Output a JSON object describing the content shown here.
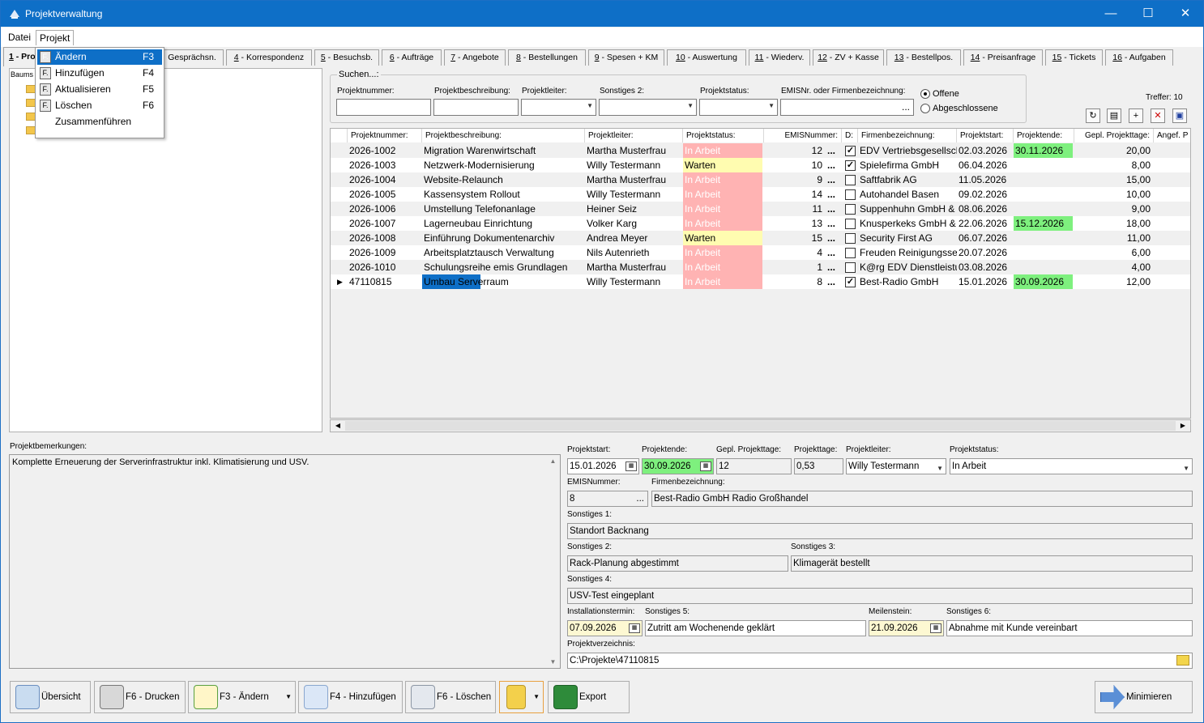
{
  "window": {
    "title": "Projektverwaltung"
  },
  "menubar": {
    "items": [
      "Datei",
      "Projekt"
    ]
  },
  "context_menu": {
    "items": [
      {
        "icon": "F.",
        "label": "Ändern",
        "key": "F3"
      },
      {
        "icon": "F.",
        "label": "Hinzufügen",
        "key": "F4"
      },
      {
        "icon": "F.",
        "label": "Aktualisieren",
        "key": "F5"
      },
      {
        "icon": "F.",
        "label": "Löschen",
        "key": "F6"
      },
      {
        "icon": "",
        "label": "Zusammenführen",
        "key": ""
      }
    ]
  },
  "tabs": [
    {
      "num": "1",
      "label": "- Pro"
    },
    {
      "num": "",
      "label": "Gesprächsn."
    },
    {
      "num": "4",
      "label": " - Korrespondenz"
    },
    {
      "num": "5",
      "label": " - Besuchsb."
    },
    {
      "num": "6",
      "label": " - Aufträge"
    },
    {
      "num": "7",
      "label": " - Angebote"
    },
    {
      "num": "8",
      "label": " - Bestellungen"
    },
    {
      "num": "9",
      "label": " - Spesen + KM"
    },
    {
      "num": "10",
      "label": " - Auswertung"
    },
    {
      "num": "11",
      "label": " - Wiederv."
    },
    {
      "num": "12",
      "label": " - ZV + Kasse"
    },
    {
      "num": "13",
      "label": " - Bestellpos."
    },
    {
      "num": "14",
      "label": " - Preisanfrage"
    },
    {
      "num": "15",
      "label": " - Tickets"
    },
    {
      "num": "16",
      "label": " - Aufgaben"
    }
  ],
  "tree": {
    "header": "Baums"
  },
  "search": {
    "legend": "Suchen...:",
    "labels": {
      "projektnummer": "Projektnummer:",
      "beschreibung": "Projektbeschreibung:",
      "leiter": "Projektleiter:",
      "sonstiges2": "Sonstiges 2:",
      "status": "Projektstatus:",
      "emis": "EMISNr. oder Firmenbezeichnung:"
    },
    "radio_open": "Offene",
    "radio_closed": "Abgeschlossene",
    "ellipsis": "..."
  },
  "treffer": "Treffer: 10",
  "grid": {
    "headers": [
      "Projektnummer:",
      "Projektbeschreibung:",
      "Projektleiter:",
      "Projektstatus:",
      "EMISNummer:",
      "D:",
      "Firmenbezeichnung:",
      "Projektstart:",
      "Projektende:",
      "Gepl. Projekttage:",
      "Angef. P"
    ],
    "rows": [
      {
        "nr": "2026-1002",
        "desc": "Migration Warenwirtschaft",
        "leiter": "Martha Musterfrau",
        "status": "In Arbeit",
        "emis": "12",
        "d": true,
        "firma": "EDV Vertriebsgesellsch",
        "start": "02.03.2026",
        "ende": "30.11.2026",
        "tage": "20,00"
      },
      {
        "nr": "2026-1003",
        "desc": "Netzwerk-Modernisierung",
        "leiter": "Willy Testermann",
        "status": "Warten",
        "emis": "10",
        "d": true,
        "firma": "Spielefirma GmbH",
        "start": "06.04.2026",
        "ende": "",
        "tage": "8,00"
      },
      {
        "nr": "2026-1004",
        "desc": "Website-Relaunch",
        "leiter": "Martha Musterfrau",
        "status": "In Arbeit",
        "emis": "9",
        "d": false,
        "firma": "Saftfabrik AG",
        "start": "11.05.2026",
        "ende": "",
        "tage": "15,00"
      },
      {
        "nr": "2026-1005",
        "desc": "Kassensystem Rollout",
        "leiter": "Willy Testermann",
        "status": "In Arbeit",
        "emis": "14",
        "d": false,
        "firma": "Autohandel Basen",
        "start": "09.02.2026",
        "ende": "",
        "tage": "10,00"
      },
      {
        "nr": "2026-1006",
        "desc": "Umstellung Telefonanlage",
        "leiter": "Heiner Seiz",
        "status": "In Arbeit",
        "emis": "11",
        "d": false,
        "firma": "Suppenhuhn GmbH & C",
        "start": "08.06.2026",
        "ende": "",
        "tage": "9,00"
      },
      {
        "nr": "2026-1007",
        "desc": "Lagerneubau Einrichtung",
        "leiter": "Volker Karg",
        "status": "In Arbeit",
        "emis": "13",
        "d": false,
        "firma": "Knusperkeks GmbH & C",
        "start": "22.06.2026",
        "ende": "15.12.2026",
        "tage": "18,00"
      },
      {
        "nr": "2026-1008",
        "desc": "Einführung Dokumentenarchiv",
        "leiter": "Andrea Meyer",
        "status": "Warten",
        "emis": "15",
        "d": false,
        "firma": "Security First AG",
        "start": "06.07.2026",
        "ende": "",
        "tage": "11,00"
      },
      {
        "nr": "2026-1009",
        "desc": "Arbeitsplatztausch Verwaltung",
        "leiter": "Nils Autenrieth",
        "status": "In Arbeit",
        "emis": "4",
        "d": false,
        "firma": "Freuden Reinigungsser",
        "start": "20.07.2026",
        "ende": "",
        "tage": "6,00"
      },
      {
        "nr": "2026-1010",
        "desc": "Schulungsreihe emis Grundlagen",
        "leiter": "Martha Musterfrau",
        "status": "In Arbeit",
        "emis": "1",
        "d": false,
        "firma": "K@rg EDV Dienstleistu",
        "start": "03.08.2026",
        "ende": "",
        "tage": "4,00"
      },
      {
        "nr": "47110815",
        "desc": "Umbau Serverraum",
        "leiter": "Willy Testermann",
        "status": "In Arbeit",
        "emis": "8",
        "d": true,
        "firma": "Best-Radio GmbH",
        "start": "15.01.2026",
        "ende": "30.09.2026",
        "tage": "12,00"
      }
    ]
  },
  "details": {
    "bemerkungen_label": "Projektbemerkungen:",
    "bemerkungen": "Komplette Erneuerung der Serverinfrastruktur inkl. Klimatisierung und USV.",
    "labels": {
      "start": "Projektstart:",
      "ende": "Projektende:",
      "gepl": "Gepl. Projekttage:",
      "tage": "Projekttage:",
      "leiter": "Projektleiter:",
      "status": "Projektstatus:",
      "emis": "EMISNummer:",
      "firma": "Firmenbezeichnung:",
      "s1": "Sonstiges 1:",
      "s2": "Sonstiges 2:",
      "s3": "Sonstiges 3:",
      "s4": "Sonstiges 4:",
      "install": "Installationstermin:",
      "s5": "Sonstiges 5:",
      "meilen": "Meilenstein:",
      "s6": "Sonstiges 6:",
      "verz": "Projektverzeichnis:"
    },
    "values": {
      "start": "15.01.2026",
      "ende": "30.09.2026",
      "gepl": "12",
      "tage": "0,53",
      "leiter": "Willy Testermann",
      "status": "In Arbeit",
      "emis": "8",
      "firma": "Best-Radio GmbH Radio Großhandel",
      "s1": "Standort Backnang",
      "s2": "Rack-Planung abgestimmt",
      "s3": "Klimagerät bestellt",
      "s4": "USV-Test eingeplant",
      "install": "07.09.2026",
      "s5": "Zutritt am Wochenende geklärt",
      "meilen": "21.09.2026",
      "s6": "Abnahme mit Kunde vereinbart",
      "verz": "C:\\Projekte\\47110815"
    }
  },
  "buttons": {
    "uebersicht": "Übersicht",
    "drucken": "F6 - Drucken",
    "aendern": "F3 - Ändern",
    "hinzufuegen": "F4 - Hinzufügen",
    "loeschen": "F6 - Löschen",
    "export": "Export",
    "minimieren": "Minimieren"
  }
}
